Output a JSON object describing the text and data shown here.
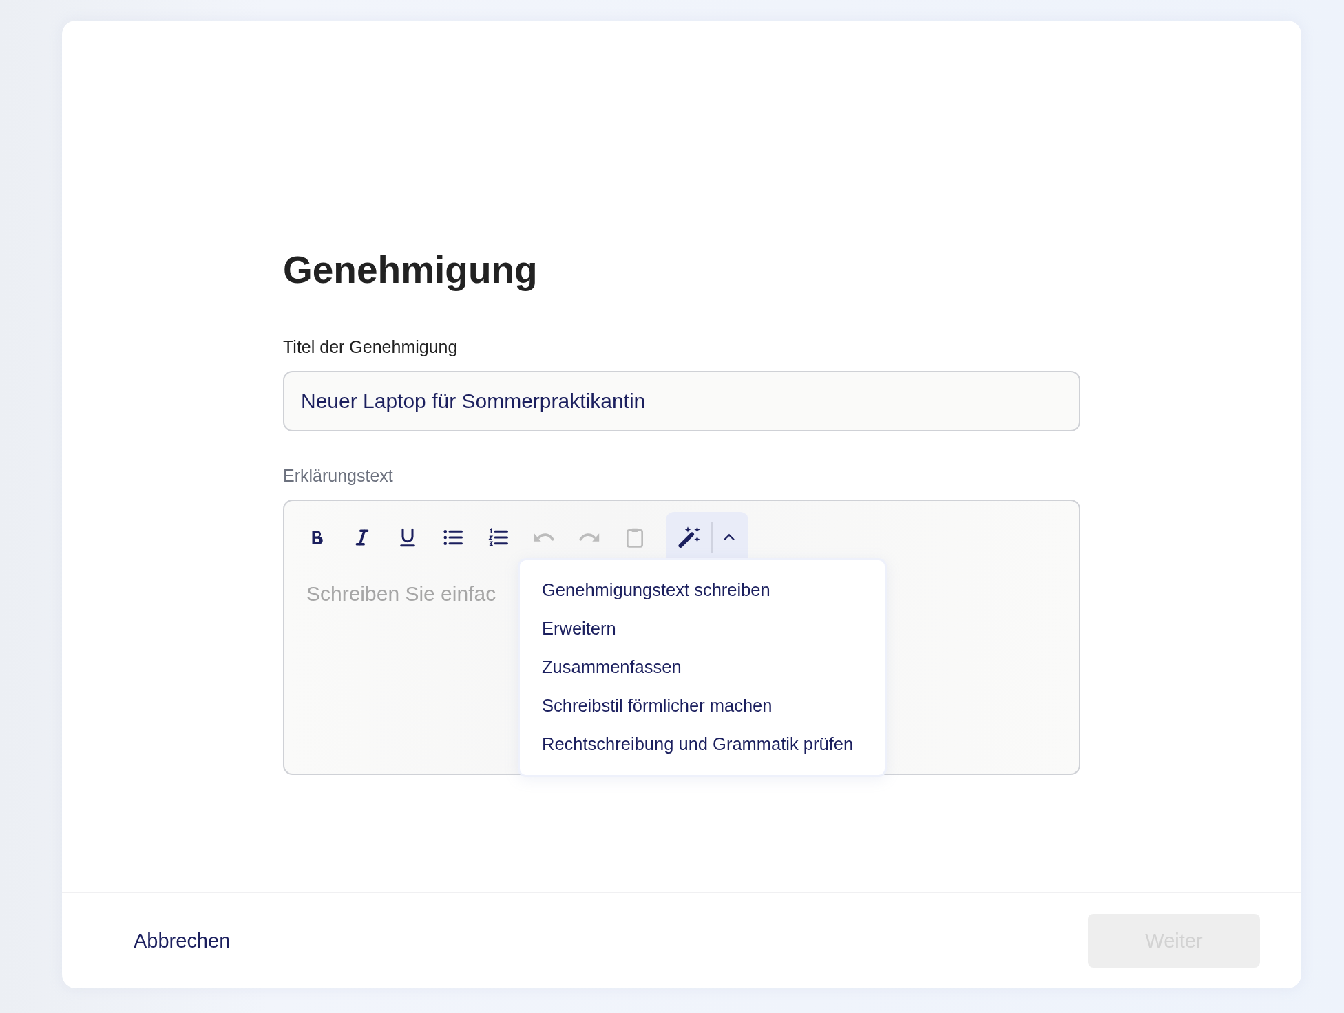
{
  "heading": "Genehmigung",
  "title_field": {
    "label": "Titel der Genehmigung",
    "value": "Neuer Laptop für Sommerpraktikantin"
  },
  "editor": {
    "label": "Erklärungstext",
    "placeholder": "Schreiben Sie einfac",
    "toolbar": [
      {
        "kind": "bold",
        "disabled": false
      },
      {
        "kind": "italic",
        "disabled": false
      },
      {
        "kind": "underline",
        "disabled": false
      },
      {
        "kind": "bullets",
        "disabled": false
      },
      {
        "kind": "numbers",
        "disabled": false
      },
      {
        "kind": "undo",
        "disabled": true
      },
      {
        "kind": "redo",
        "disabled": true
      },
      {
        "kind": "clipboard",
        "disabled": true
      }
    ],
    "ai_menu": {
      "expanded": true,
      "items": [
        "Genehmigungstext schreiben",
        "Erweitern",
        "Zusammenfassen",
        "Schreibstil förmlicher machen",
        "Rechtschreibung und Grammatik prüfen"
      ]
    }
  },
  "footer": {
    "cancel": "Abbrechen",
    "next": {
      "label": "Weiter",
      "disabled": true
    }
  }
}
